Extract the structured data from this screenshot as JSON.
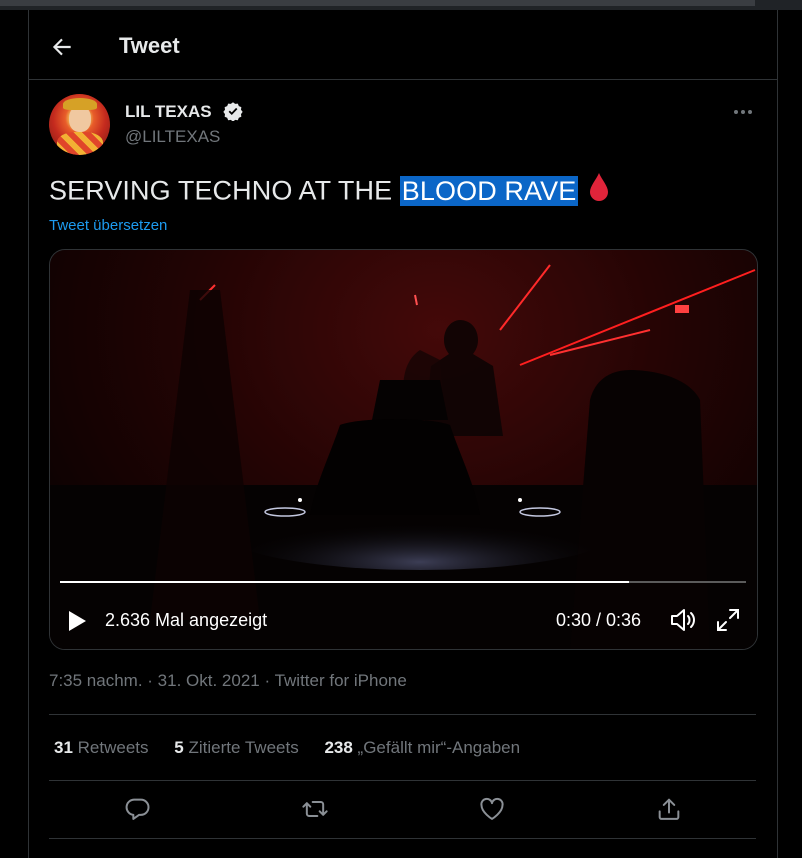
{
  "header": {
    "title": "Tweet"
  },
  "author": {
    "name": "LIL TEXAS",
    "handle": "@LILTEXAS",
    "verified": true
  },
  "tweet": {
    "text_before": "SERVING TECHNO AT THE ",
    "text_highlight": "BLOOD RAVE",
    "translate_label": "Tweet übersetzen"
  },
  "video": {
    "views": "2.636 Mal angezeigt",
    "time": "0:30 / 0:36",
    "progress": 0.829
  },
  "meta": {
    "time": "7:35 nachm.",
    "date": "31. Okt. 2021",
    "source": "Twitter for iPhone",
    "separator": " · "
  },
  "stats": {
    "retweets": {
      "count": "31",
      "label": "Retweets"
    },
    "quotes": {
      "count": "5",
      "label": "Zitierte Tweets"
    },
    "likes": {
      "count": "238",
      "label": "„Gefällt mir“-Angaben"
    }
  },
  "icons": {
    "back": "arrow-left-icon",
    "verified": "verified-badge-icon",
    "more": "more-horizontal-icon",
    "drop": "blood-drop-icon",
    "play": "play-icon",
    "volume": "volume-icon",
    "fullscreen": "fullscreen-icon",
    "reply": "reply-icon",
    "retweet": "retweet-icon",
    "like": "heart-icon",
    "share": "share-icon"
  },
  "colors": {
    "accent": "#1d9bf0",
    "background": "#000000",
    "muted": "#71767b",
    "highlight": "#0b66c7",
    "drop": "#e0243a"
  }
}
